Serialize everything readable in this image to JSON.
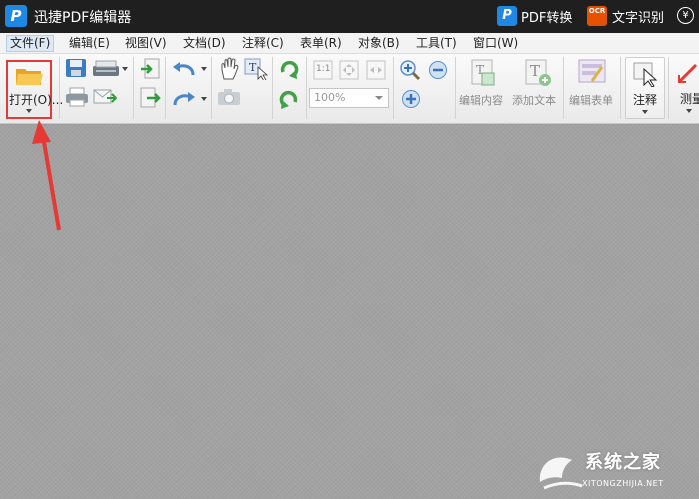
{
  "titlebar": {
    "app_logo": "P",
    "app_title": "迅捷PDF编辑器",
    "pdf_convert_icon": "P",
    "pdf_convert_label": "PDF转换",
    "ocr_icon_text": "OCR",
    "ocr_label": "文字识别",
    "currency_icon": "¥"
  },
  "menu": {
    "items": [
      {
        "label": "文件(F)"
      },
      {
        "label": "编辑(E)"
      },
      {
        "label": "视图(V)"
      },
      {
        "label": "文档(D)"
      },
      {
        "label": "注释(C)"
      },
      {
        "label": "表单(R)"
      },
      {
        "label": "对象(B)"
      },
      {
        "label": "工具(T)"
      },
      {
        "label": "窗口(W)"
      }
    ]
  },
  "toolbar": {
    "open_label": "打开(O)...",
    "zoom_value": "100%",
    "edit_content_label": "编辑内容",
    "add_text_label": "添加文本",
    "edit_form_label": "编辑表单",
    "annotate_label": "注释",
    "measure_label": "测量",
    "page_fit_label": "1:1"
  },
  "watermark": {
    "brand": "系统之家",
    "url": "XITONGZHIJIA.NET"
  },
  "colors": {
    "accent_red": "#e53935",
    "titlebar_bg": "#1f1f1f",
    "brand_blue": "#1e88e5",
    "ocr_orange": "#e65100"
  },
  "icons": [
    "folder-open-icon",
    "save-icon",
    "scanner-icon",
    "print-icon",
    "email-icon",
    "import-icon",
    "export-icon",
    "undo-icon",
    "redo-icon",
    "hand-tool-icon",
    "select-text-icon",
    "snapshot-icon",
    "rotate-cw-icon",
    "rotate-ccw-icon",
    "actual-size-icon",
    "fit-page-icon",
    "fit-width-icon",
    "zoom-in-icon",
    "zoom-out-icon",
    "zoom-plus-icon",
    "edit-content-icon",
    "add-text-icon",
    "edit-form-icon",
    "annotate-icon",
    "measure-icon"
  ]
}
